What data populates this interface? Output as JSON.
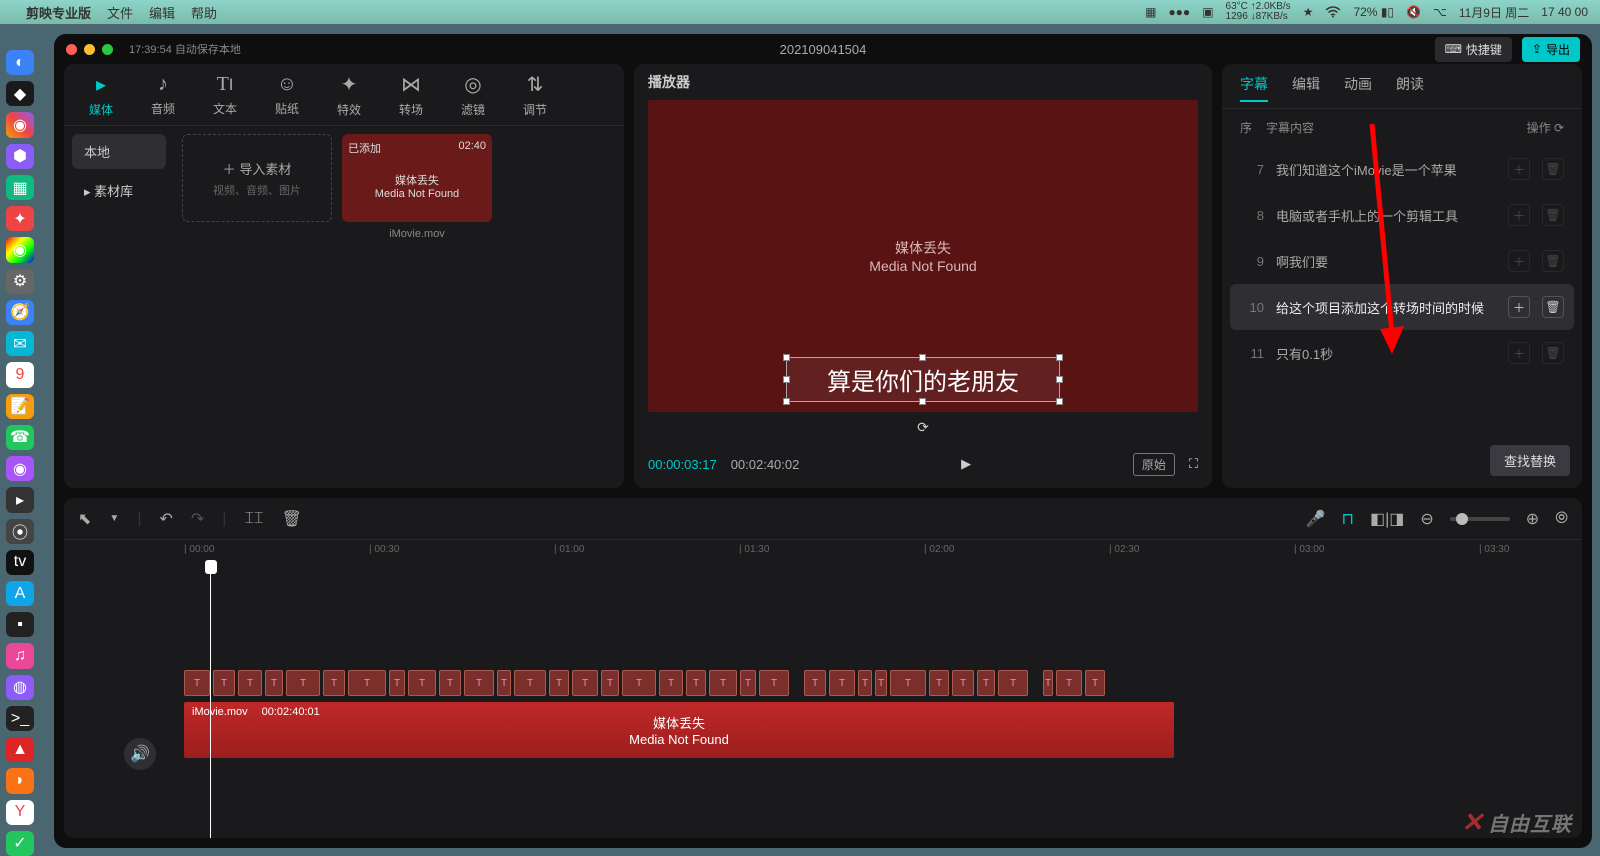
{
  "menubar": {
    "app_name": "剪映专业版",
    "items": [
      "文件",
      "编辑",
      "帮助"
    ],
    "temp": "63°C",
    "net_up": "↑2.0KB/s",
    "net_ram": "1296",
    "net_down": "↓87KB/s",
    "battery": "72%",
    "date": "11月9日 周二",
    "time": "17 40 00"
  },
  "titlebar": {
    "autosave": "17:39:54 自动保存本地",
    "project": "202109041504",
    "shortcut": "快捷键",
    "export": "导出"
  },
  "media_tabs": [
    {
      "icon": "▸",
      "label": "媒体"
    },
    {
      "icon": "♪",
      "label": "音频"
    },
    {
      "icon": "T",
      "label": "文本"
    },
    {
      "icon": "☺",
      "label": "贴纸"
    },
    {
      "icon": "✦",
      "label": "特效"
    },
    {
      "icon": "⋈",
      "label": "转场"
    },
    {
      "icon": "◎",
      "label": "滤镜"
    },
    {
      "icon": "⇅",
      "label": "调节"
    }
  ],
  "media_side": {
    "local": "本地",
    "library": "素材库"
  },
  "import_card": {
    "title": "导入素材",
    "sub": "视频、音频、图片"
  },
  "clip": {
    "badge": "已添加",
    "duration": "02:40",
    "lost": "媒体丢失",
    "lost_en": "Media Not Found",
    "name": "iMovie.mov"
  },
  "preview": {
    "title": "播放器",
    "lost": "媒体丢失",
    "lost_en": "Media Not Found",
    "caption": "算是你们的老朋友",
    "time_cur": "00:00:03:17",
    "time_total": "00:02:40:02",
    "ratio": "原始"
  },
  "sub_tabs": [
    "字幕",
    "编辑",
    "动画",
    "朗读"
  ],
  "sub_header": {
    "seq": "序",
    "content": "字幕内容",
    "op": "操作"
  },
  "subtitles": [
    {
      "n": "7",
      "t": "我们知道这个iMovie是一个苹果"
    },
    {
      "n": "8",
      "t": "电脑或者手机上的一个剪辑工具"
    },
    {
      "n": "9",
      "t": "啊我们要"
    },
    {
      "n": "10",
      "t": "给这个项目添加这个转场时间的时候"
    },
    {
      "n": "11",
      "t": "只有0.1秒"
    }
  ],
  "find_replace": "查找替换",
  "timeline": {
    "marks": [
      "00:00",
      "00:30",
      "01:00",
      "01:30",
      "02:00",
      "02:30",
      "03:00",
      "03:30"
    ],
    "video_name": "iMovie.mov",
    "video_dur": "00:02:40:01",
    "lost": "媒体丢失",
    "lost_en": "Media Not Found"
  },
  "watermark": "自由互联"
}
